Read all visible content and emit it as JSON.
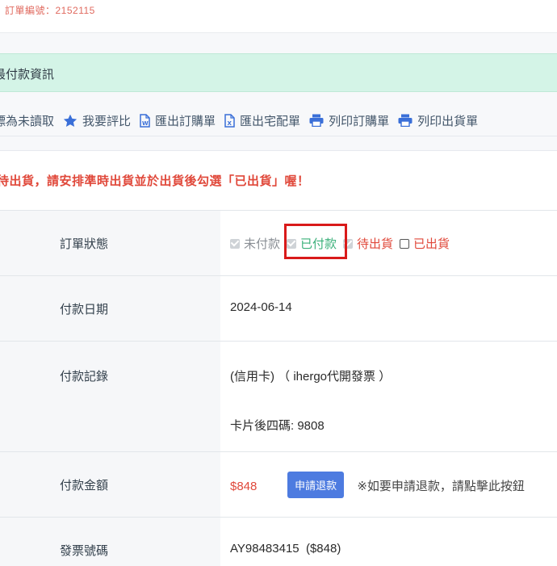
{
  "order": {
    "number_label": "訂單編號：2152115"
  },
  "status_header": {
    "title": "最付款資訊"
  },
  "toolbar": {
    "items": [
      {
        "label": "標為未讀取",
        "icon": "none"
      },
      {
        "label": "我要評比",
        "icon": "star-icon"
      },
      {
        "label": "匯出訂購單",
        "icon": "word-doc-icon"
      },
      {
        "label": "匯出宅配單",
        "icon": "excel-doc-icon"
      },
      {
        "label": "列印訂購單",
        "icon": "print-icon"
      },
      {
        "label": "列印出貨單",
        "icon": "print-icon"
      }
    ]
  },
  "notice": "待出貨，請安排準時出貨並於出貨後勾選「已出貨」喔！",
  "rows": {
    "status": {
      "label": "訂單狀態",
      "options": [
        {
          "label": "未付款",
          "checked": true
        },
        {
          "label": "已付款",
          "checked": true
        },
        {
          "label": "待出貨",
          "checked": true
        },
        {
          "label": "已出貨",
          "checked": false
        }
      ]
    },
    "pay_date": {
      "label": "付款日期",
      "value": "2024-06-14"
    },
    "pay_record": {
      "label": "付款記錄",
      "line1": "(信用卡) （ ihergo代開發票 ）",
      "line2": "卡片後四碼: 9808"
    },
    "pay_amount": {
      "label": "付款金額",
      "value": "$848",
      "button": "申請退款",
      "note": "※如要申請退款，請點擊此按鈕"
    },
    "invoice": {
      "label": "發票號碼",
      "value": "AY98483415  ($848)"
    }
  },
  "colors": {
    "accent_blue": "#4d7be0",
    "status_green": "#3bb07a",
    "alert_red": "#e0483a",
    "header_green_bg": "#d4f4e7"
  }
}
